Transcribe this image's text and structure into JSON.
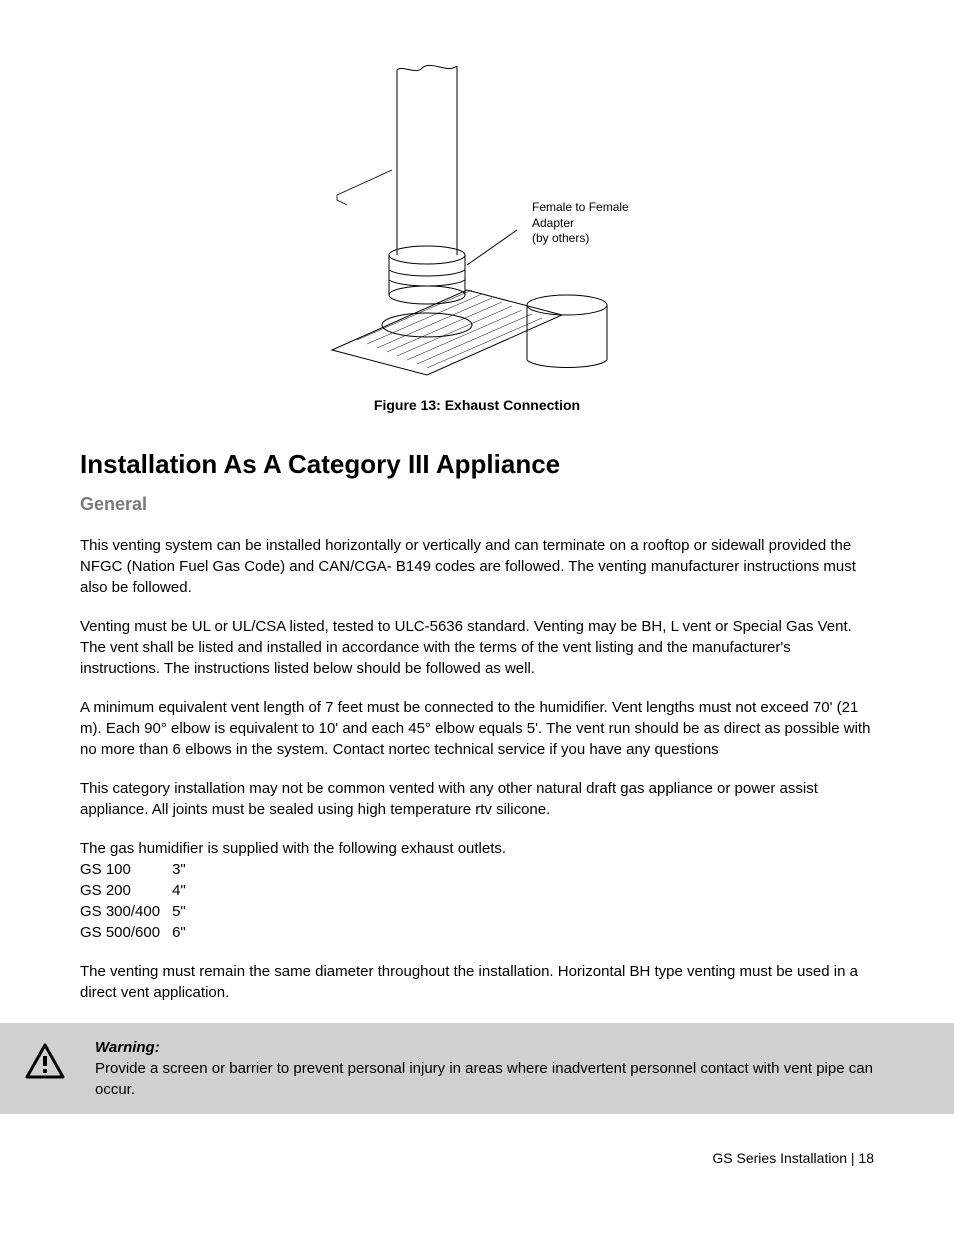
{
  "figure": {
    "caption": "Figure 13: Exhaust Connection",
    "label_line1": "Female to Female",
    "label_line2": "Adapter",
    "label_line3": "(by others)"
  },
  "heading": "Installation As A Category III Appliance",
  "subheading": "General",
  "para1": "This venting system can be installed horizontally or vertically and can terminate on a rooftop or sidewall provided the NFGC (Nation Fuel Gas Code) and CAN/CGA- B149 codes are followed. The venting manufacturer instructions must also be followed.",
  "para2": "Venting must be UL or UL/CSA listed, tested to ULC-5636 standard. Venting may be BH, L vent or Special Gas Vent. The vent shall be listed and installed in accordance with the terms of the vent listing and the manufacturer's instructions. The instructions listed below should be followed as well.",
  "para3": "A minimum equivalent vent length of 7 feet must be connected to the humidifier.  Vent lengths must not exceed 70' (21 m). Each 90° elbow is equivalent to 10' and each 45° elbow equals 5'.  The vent run should be as direct as possible with no more than 6 elbows in the system. Contact nortec technical service if you have any questions",
  "para4": "This category installation may not be common vented with any other natural draft gas appliance or power assist appliance.  All joints must be sealed using high temperature rtv silicone.",
  "para5": "The gas humidifier is supplied with the following exhaust outlets.",
  "outlets": [
    {
      "model": "GS 100",
      "size": "3\""
    },
    {
      "model": "GS 200",
      "size": "4\""
    },
    {
      "model": "GS 300/400",
      "size": "5\""
    },
    {
      "model": "GS 500/600",
      "size": "6\""
    }
  ],
  "para6": "The venting must remain the same diameter throughout the installation.  Horizontal BH type venting must be used in a direct vent application.",
  "warning": {
    "title": "Warning:",
    "body": "Provide a screen or barrier to prevent personal injury in areas where inadvertent personnel contact with vent pipe can occur."
  },
  "footer": "GS Series Installation | 18"
}
